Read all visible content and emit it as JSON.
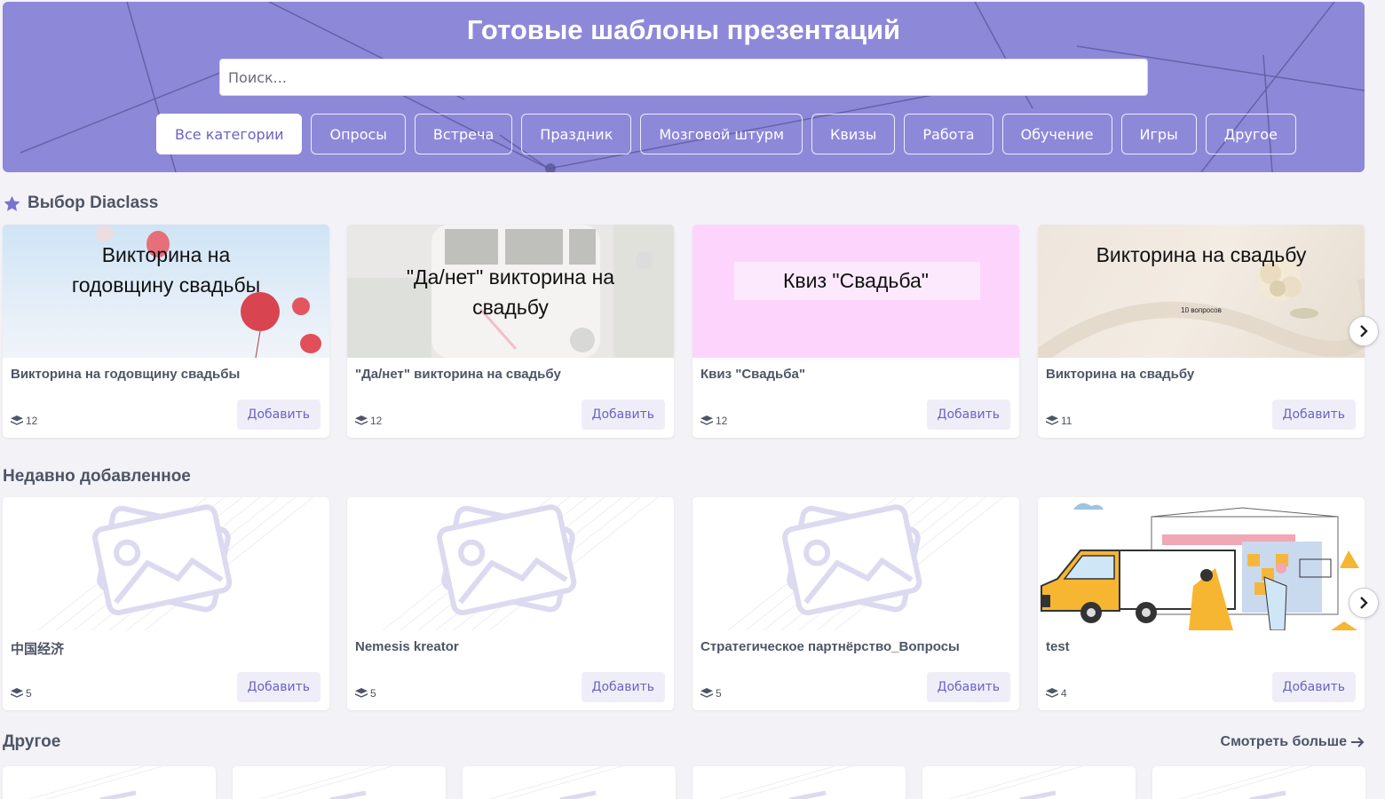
{
  "hero": {
    "title": "Готовые шаблоны презентаций",
    "search_placeholder": "Поиск...",
    "categories": [
      "Все категории",
      "Опросы",
      "Встреча",
      "Праздник",
      "Мозговой штурм",
      "Квизы",
      "Работа",
      "Обучение",
      "Игры",
      "Другое"
    ],
    "active_category": "Все категории"
  },
  "sections": {
    "featured": {
      "title": "Выбор Diaclass",
      "cards": [
        {
          "thumb_lines": [
            "Викторина на",
            "годовщину свадьбы"
          ],
          "title": "Викторина на годовщину свадьбы",
          "count": "12",
          "add": "Добавить"
        },
        {
          "thumb_lines": [
            "\"Да/нет\" викторина на",
            "свадьбу"
          ],
          "title": "\"Да/нет\" викторина на свадьбу",
          "count": "12",
          "add": "Добавить"
        },
        {
          "thumb_lines": [
            "Квиз \"Свадьба\""
          ],
          "title": "Квиз \"Свадьба\"",
          "count": "12",
          "add": "Добавить"
        },
        {
          "thumb_lines": [
            "Викторина на свадьбу"
          ],
          "thumb_sub": "10 вопросов",
          "title": "Викторина на свадьбу",
          "count": "11",
          "add": "Добавить"
        }
      ]
    },
    "recent": {
      "title": "Недавно добавленное",
      "cards": [
        {
          "title": "中国经济",
          "count": "5",
          "add": "Добавить"
        },
        {
          "title": "Nemesis kreator",
          "count": "5",
          "add": "Добавить"
        },
        {
          "title": "Стратегическое партнёрство_Вопросы",
          "count": "5",
          "add": "Добавить"
        },
        {
          "title": "test",
          "count": "4",
          "add": "Добавить"
        }
      ]
    },
    "other": {
      "title": "Другое",
      "more": "Смотреть больше"
    }
  },
  "icons": {
    "star": "star-icon",
    "slides": "layers-icon",
    "next": "chevron-right-icon",
    "more": "arrow-right-icon",
    "placeholder": "image-placeholder-icon"
  },
  "colors": {
    "accent": "#8e88d9",
    "accent_text": "#6b62c4",
    "background": "#f3f2f7"
  }
}
